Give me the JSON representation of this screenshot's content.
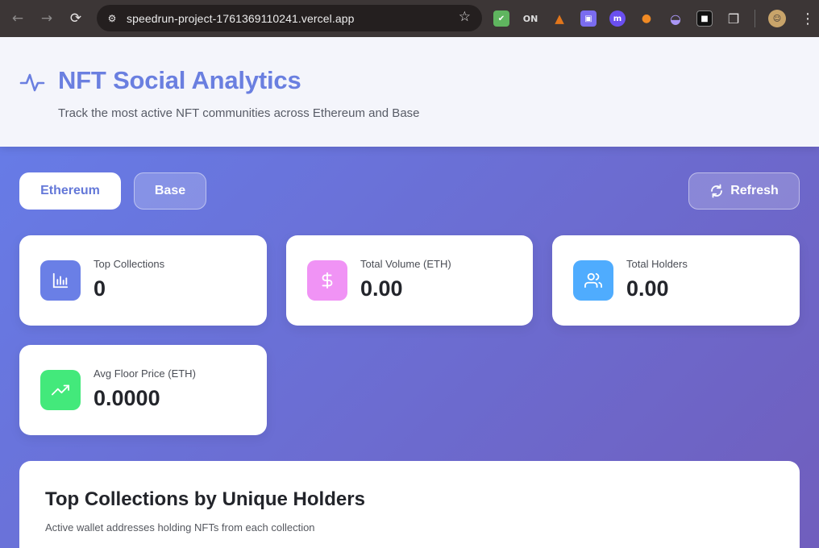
{
  "browser": {
    "url": "speedrun-project-1761369110241.vercel.app",
    "extensions": [
      {
        "name": "shield-extension-icon",
        "color": "#5fb55f",
        "glyph": "✔"
      },
      {
        "name": "on-extension-icon",
        "color": "#3c3636",
        "glyph": "ON"
      },
      {
        "name": "fox-extension-icon",
        "color": "#e2761b",
        "glyph": "▲"
      },
      {
        "name": "purple-square-extension-icon",
        "color": "#7a6cf0",
        "glyph": "▣"
      },
      {
        "name": "m-extension-icon",
        "color": "#6a4ff0",
        "glyph": "m"
      },
      {
        "name": "orange-dot-extension-icon",
        "color": "#1b1b1b",
        "glyph": "●"
      },
      {
        "name": "ghost-extension-icon",
        "color": "#a996f5",
        "glyph": "◒"
      },
      {
        "name": "black-square-extension-icon",
        "color": "#111111",
        "glyph": "■"
      },
      {
        "name": "puzzle-extension-icon",
        "color": "#3c3636",
        "glyph": "❐"
      }
    ]
  },
  "header": {
    "title": "NFT Social Analytics",
    "subtitle": "Track the most active NFT communities across Ethereum and Base"
  },
  "controls": {
    "chains": [
      "Ethereum",
      "Base"
    ],
    "selected_chain": "Ethereum",
    "refresh_label": "Refresh"
  },
  "stats": [
    {
      "label": "Top Collections",
      "value": "0",
      "icon": "bar-chart-icon",
      "color": "#6a7fe6"
    },
    {
      "label": "Total Volume (ETH)",
      "value": "0.00",
      "icon": "dollar-icon",
      "color": "#f093f5"
    },
    {
      "label": "Total Holders",
      "value": "0.00",
      "icon": "users-icon",
      "color": "#4facfe"
    },
    {
      "label": "Avg Floor Price (ETH)",
      "value": "0.0000",
      "icon": "trending-up-icon",
      "color": "#43e97b"
    }
  ],
  "panel": {
    "title": "Top Collections by Unique Holders",
    "subtitle": "Active wallet addresses holding NFTs from each collection"
  }
}
